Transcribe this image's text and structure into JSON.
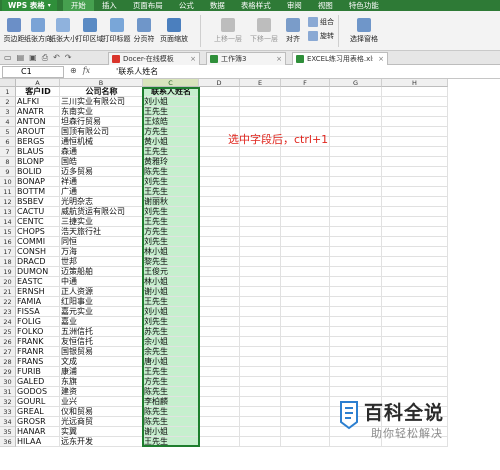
{
  "menubar": {
    "app_label": "WPS 表格",
    "items": [
      "开始",
      "插入",
      "页面布局",
      "公式",
      "数据",
      "表格样式",
      "审阅",
      "视图",
      "特色功能"
    ],
    "active_index": 0,
    "colors": {
      "bar": "#2e7a36",
      "active": "#46a04f"
    }
  },
  "ribbon": {
    "buttons": [
      {
        "label": "页边距",
        "icon": "margins-icon",
        "color": "#6b8fc7"
      },
      {
        "label": "纸张方向",
        "icon": "orientation-icon",
        "color": "#7aa3d6"
      },
      {
        "label": "纸张大小",
        "icon": "paper-size-icon",
        "color": "#8fb2dd"
      },
      {
        "label": "打印区域",
        "icon": "print-area-icon",
        "color": "#5b8bc4"
      },
      {
        "label": "打印标题",
        "icon": "print-title-icon",
        "color": "#79a6d8"
      },
      {
        "label": "分页符",
        "icon": "page-break-icon",
        "color": "#6f96c9"
      },
      {
        "label": "页面缩放",
        "icon": "page-zoom-icon",
        "color": "#4b7fbe"
      },
      {
        "label": "上移一层",
        "icon": "bring-forward-icon",
        "color": "#bdbdbd"
      },
      {
        "label": "下移一层",
        "icon": "send-backward-icon",
        "color": "#bdbdbd"
      },
      {
        "label": "对齐",
        "icon": "align-icon",
        "color": "#7a9cc9"
      },
      {
        "label": "选择窗格",
        "icon": "selection-pane-icon",
        "color": "#6f96c9"
      }
    ],
    "small_buttons": [
      {
        "label": "组合",
        "icon": "group-icon"
      },
      {
        "label": "旋转",
        "icon": "rotate-icon"
      }
    ]
  },
  "doctabs": {
    "tabs": [
      {
        "label": "Docer-在线模板",
        "icon": "docer-icon",
        "color": "#d9342b",
        "active": false
      },
      {
        "label": "工作簿3",
        "icon": "workbook-icon",
        "color": "#2f8f3a",
        "active": false
      },
      {
        "label": "EXCEL练习用表格.xls",
        "icon": "excel-file-icon",
        "color": "#2f8f3a",
        "active": true
      }
    ]
  },
  "formula_bar": {
    "name_box": "C1",
    "formula": "'联系人姓名"
  },
  "grid": {
    "columns": [
      "A",
      "B",
      "C",
      "D",
      "E",
      "F",
      "G",
      "H"
    ],
    "selected_column": "C",
    "header_row": [
      "客户ID",
      "公司名称",
      "联系人姓名"
    ],
    "rows": [
      [
        "ALFKI",
        "三川实业有限公司",
        "刘小姐"
      ],
      [
        "ANATR",
        "东南实业",
        "王先生"
      ],
      [
        "ANTON",
        "坦森行贸易",
        "王炫皓"
      ],
      [
        "AROUT",
        "国顶有限公司",
        "方先生"
      ],
      [
        "BERGS",
        "通恒机械",
        "黄小姐"
      ],
      [
        "BLAUS",
        "森通",
        "王先生"
      ],
      [
        "BLONP",
        "国皓",
        "黄雅玲"
      ],
      [
        "BOLID",
        "迈多贸易",
        "陈先生"
      ],
      [
        "BONAP",
        "祥通",
        "刘先生"
      ],
      [
        "BOTTM",
        "广通",
        "王先生"
      ],
      [
        "BSBEV",
        "光明杂志",
        "谢丽秋"
      ],
      [
        "CACTU",
        "威航货运有限公司",
        "刘先生"
      ],
      [
        "CENTC",
        "三捷实业",
        "王先生"
      ],
      [
        "CHOPS",
        "浩天旅行社",
        "方先生"
      ],
      [
        "COMMI",
        "同恒",
        "刘先生"
      ],
      [
        "CONSH",
        "万海",
        "林小姐"
      ],
      [
        "DRACD",
        "世邦",
        "黎先生"
      ],
      [
        "DUMON",
        "迈策船舶",
        "王俊元"
      ],
      [
        "EASTC",
        "中通",
        "林小姐"
      ],
      [
        "ERNSH",
        "正人资源",
        "谢小姐"
      ],
      [
        "FAMIA",
        "红阳事业",
        "王先生"
      ],
      [
        "FISSA",
        "嘉元实业",
        "刘小姐"
      ],
      [
        "FOLIG",
        "嘉业",
        "刘先生"
      ],
      [
        "FOLKO",
        "五洲信托",
        "苏先生"
      ],
      [
        "FRANK",
        "友恒信托",
        "余小姐"
      ],
      [
        "FRANR",
        "国银贸易",
        "余先生"
      ],
      [
        "FRANS",
        "文成",
        "唐小姐"
      ],
      [
        "FURIB",
        "康浦",
        "王先生"
      ],
      [
        "GALED",
        "东旗",
        "方先生"
      ],
      [
        "GODOS",
        "建资",
        "陈先生"
      ],
      [
        "GOURL",
        "业兴",
        "李柏麟"
      ],
      [
        "GREAL",
        "仪和贸易",
        "陈先生"
      ],
      [
        "GROSR",
        "光远商贸",
        "陈先生"
      ],
      [
        "HANAR",
        "实翼",
        "谢小姐"
      ],
      [
        "HILAA",
        "远东开发",
        "王先生"
      ]
    ]
  },
  "annotation": "选中字段后，ctrl+1",
  "watermark": {
    "title": "百科全说",
    "subtitle": "助你轻松解决"
  }
}
